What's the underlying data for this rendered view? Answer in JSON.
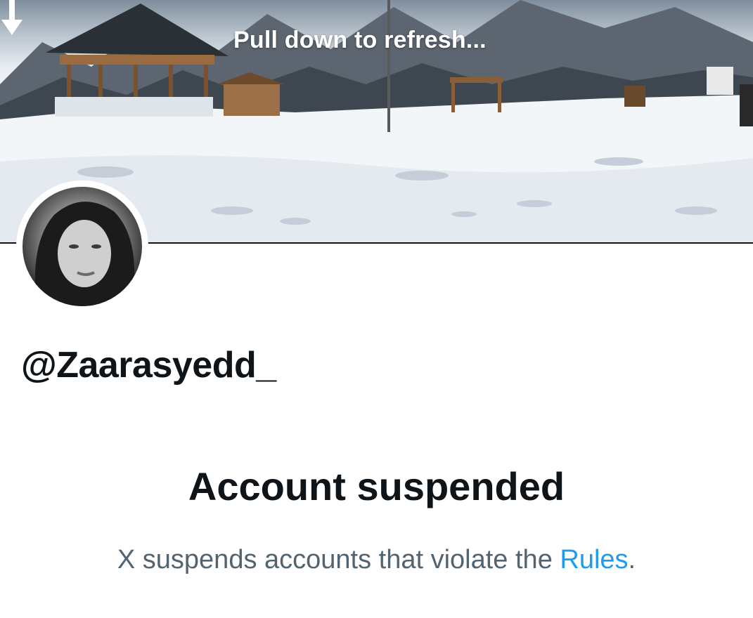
{
  "banner": {
    "refresh_text": "Pull down to refresh...",
    "arrow_icon": "arrow-down-icon"
  },
  "profile": {
    "handle": "@Zaarasyedd_"
  },
  "status": {
    "title": "Account suspended",
    "description_prefix": "X suspends accounts that violate the ",
    "rules_link": "Rules",
    "description_suffix": "."
  },
  "colors": {
    "link": "#1d9bf0",
    "text_primary": "#0f1419",
    "text_secondary": "#536471"
  }
}
